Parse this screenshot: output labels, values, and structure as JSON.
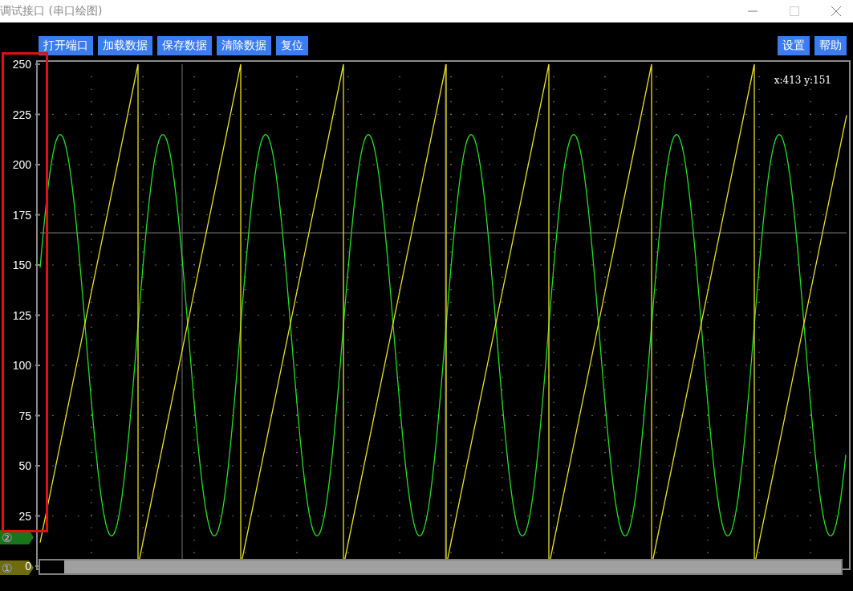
{
  "window": {
    "title": "调试接口 (串口绘图)"
  },
  "toolbar": {
    "left_buttons": [
      "打开端口",
      "加载数据",
      "保存数据",
      "清除数据",
      "复位"
    ],
    "right_buttons": [
      "设置",
      "帮助"
    ]
  },
  "plot": {
    "cursor_readout": "x:413 y:151",
    "y_axis_labels": [
      "250",
      "225",
      "200",
      "175",
      "150",
      "125",
      "100",
      "75",
      "50",
      "25",
      "0"
    ],
    "channels": [
      {
        "marker": "②",
        "color": "#17761a",
        "kind": "sine"
      },
      {
        "marker": "①",
        "color": "#6e6c0c",
        "kind": "sawtooth"
      }
    ]
  }
}
